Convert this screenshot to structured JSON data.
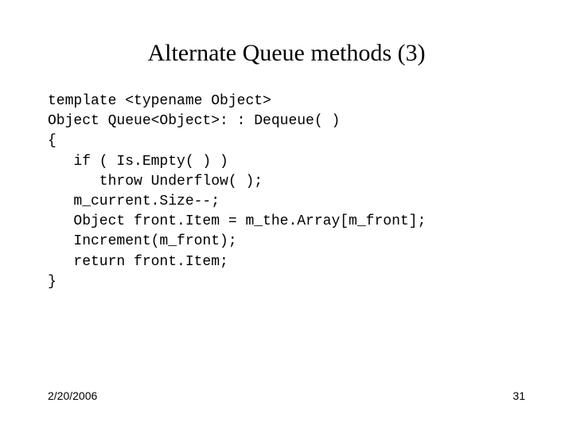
{
  "title": "Alternate Queue methods (3)",
  "code": {
    "l1": "template <typename Object>",
    "l2": "Object Queue<Object>: : Dequeue( )",
    "l3": "{",
    "l4": "   if ( Is.Empty( ) )",
    "l5": "      throw Underflow( );",
    "l6": "   m_current.Size--;",
    "l7": "   Object front.Item = m_the.Array[m_front];",
    "l8": "   Increment(m_front);",
    "l9": "   return front.Item;",
    "l10": "}"
  },
  "footer": {
    "date": "2/20/2006",
    "page": "31"
  }
}
